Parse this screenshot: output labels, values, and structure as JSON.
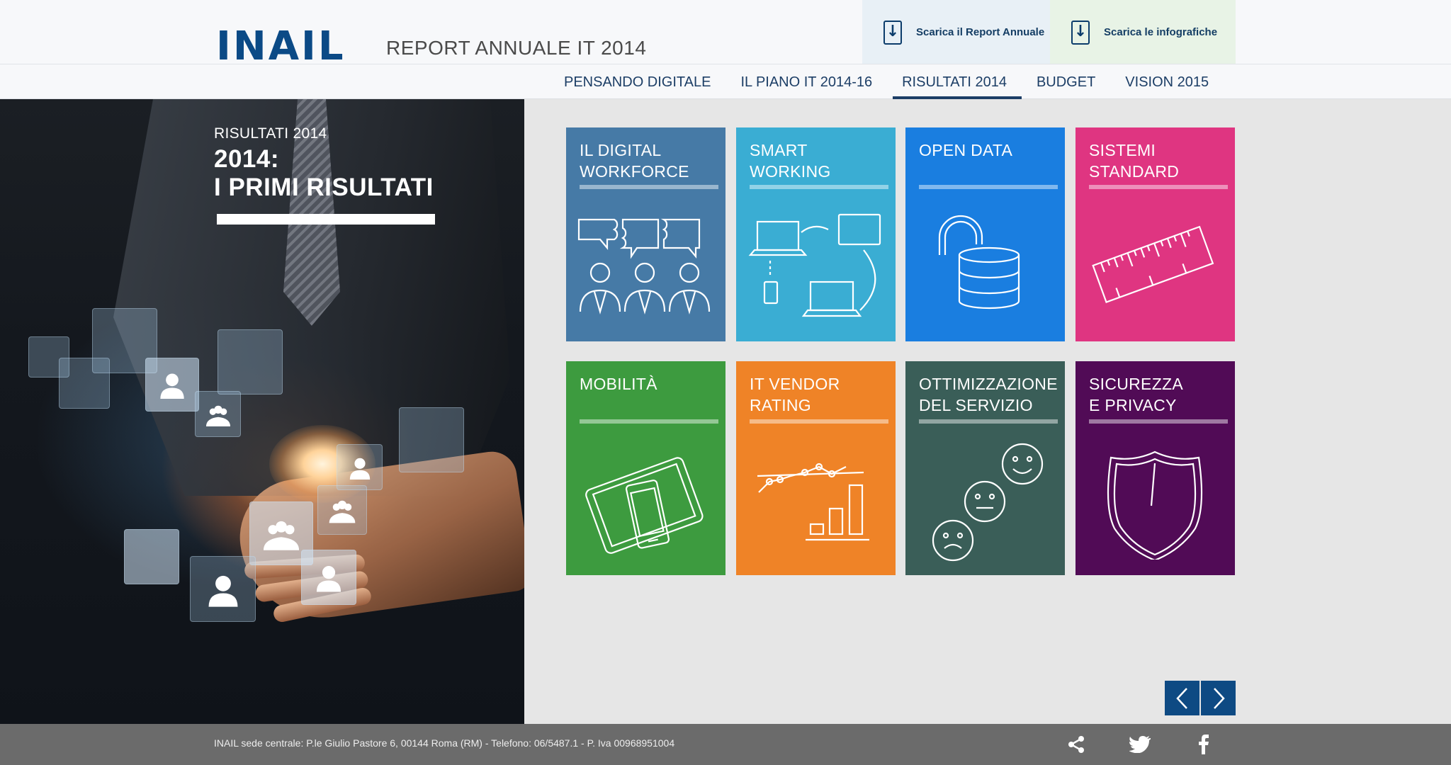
{
  "header": {
    "logo": "INAIL",
    "site_title": "REPORT ANNUALE IT 2014",
    "downloads": {
      "report_label": "Scarica il Report Annuale",
      "info_label": "Scarica le infografiche"
    }
  },
  "nav": {
    "items": [
      {
        "label": "PENSANDO DIGITALE"
      },
      {
        "label": "IL PIANO IT 2014-16"
      },
      {
        "label": "RISULTATI 2014",
        "active": true
      },
      {
        "label": "BUDGET"
      },
      {
        "label": "VISION 2015"
      }
    ]
  },
  "hero": {
    "kicker": "RISULTATI 2014",
    "title_line1": "2014:",
    "title_line2": "I PRIMI RISULTATI"
  },
  "tiles": [
    {
      "line1": "IL DIGITAL",
      "line2": "WORKFORCE",
      "color": "#467aa6",
      "icon": "workforce-icon"
    },
    {
      "line1": "SMART",
      "line2": "WORKING",
      "color": "#3aadd3",
      "icon": "devices-sync-icon"
    },
    {
      "line1": "OPEN DATA",
      "line2": "",
      "color": "#1a7ee0",
      "icon": "open-database-icon"
    },
    {
      "line1": "SISTEMI",
      "line2": "STANDARD",
      "color": "#df3581",
      "icon": "ruler-icon"
    },
    {
      "line1": "MOBILITÀ",
      "line2": "",
      "color": "#3d9b3f",
      "icon": "tablet-phone-icon"
    },
    {
      "line1": "IT VENDOR",
      "line2": "RATING",
      "color": "#ef8327",
      "icon": "rating-chart-icon"
    },
    {
      "line1": "OTTIMIZZAZIONE",
      "line2": "DEL SERVIZIO",
      "color": "#3a5e58",
      "icon": "smiley-scale-icon"
    },
    {
      "line1": "SICUREZZA",
      "line2": "E PRIVACY",
      "color": "#510b56",
      "icon": "shield-icon"
    }
  ],
  "pager": {
    "prev_icon": "chevron-left-icon",
    "next_icon": "chevron-right-icon"
  },
  "footer": {
    "text": "INAIL sede centrale: P.le Giulio Pastore 6, 00144 Roma (RM) - Telefono: 06/5487.1 - P. Iva 00968951004",
    "social": [
      "share-icon",
      "twitter-icon",
      "facebook-icon"
    ]
  }
}
